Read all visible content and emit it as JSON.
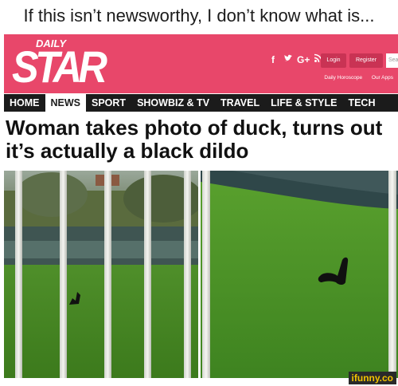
{
  "caption": "If this isn’t newsworthy, I don’t know what is...",
  "brand": {
    "top": "DAILY",
    "name": "STAR",
    "color": "#e8476a"
  },
  "socials": [
    {
      "icon": "facebook-icon",
      "glyph": "f"
    },
    {
      "icon": "twitter-icon",
      "glyph": "🐦"
    },
    {
      "icon": "google-plus-icon",
      "glyph": "G+"
    },
    {
      "icon": "rss-icon",
      "glyph": "⌁"
    }
  ],
  "account": {
    "login": "Login",
    "register": "Register",
    "search_placeholder": "Search"
  },
  "sublinks": [
    "Daily Horoscope",
    "Our Apps"
  ],
  "nav": {
    "items": [
      "HOME",
      "NEWS",
      "SPORT",
      "SHOWBIZ & TV",
      "TRAVEL",
      "LIFE & STYLE",
      "TECH"
    ],
    "active": "NEWS"
  },
  "headline": "Woman takes photo of duck, turns out it’s actually a black dildo",
  "watermark": "ifunny.co"
}
